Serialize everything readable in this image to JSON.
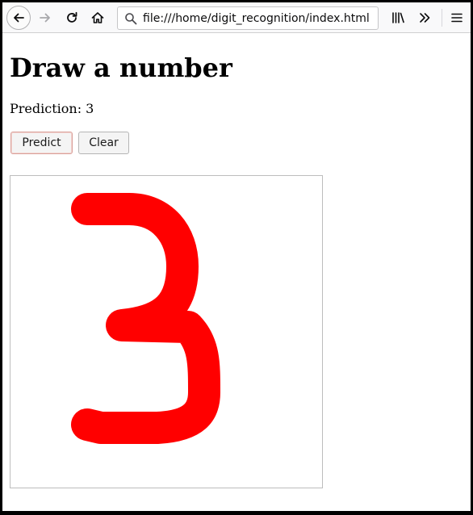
{
  "browser": {
    "url": "file:///home/digit_recognition/index.html",
    "icons": {
      "back": "back-arrow-icon",
      "forward": "forward-arrow-icon",
      "reload": "reload-icon",
      "home": "home-icon",
      "search": "search-icon",
      "library": "library-icon",
      "overflow": "chevron-double-right-icon",
      "menu": "hamburger-menu-icon"
    }
  },
  "page": {
    "title": "Draw a number",
    "prediction_label": "Prediction:",
    "prediction_value": "3",
    "buttons": {
      "predict": "Predict",
      "clear": "Clear"
    }
  },
  "canvas": {
    "stroke_color": "#ff0000",
    "drawn_digit": "3"
  }
}
